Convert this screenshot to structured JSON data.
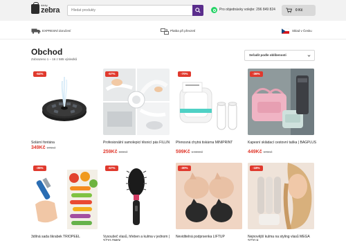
{
  "header": {
    "logo_small": "dárky",
    "logo_text": "zebra",
    "search_placeholder": "Hledat produkty",
    "phone_text": "Pro objednávky volejte: 296 849 824",
    "cart_price": "0 Kč"
  },
  "benefits": [
    {
      "icon": "truck-icon",
      "label": "EXPRESNÍ doručení"
    },
    {
      "icon": "exchange-icon",
      "label": "Platba při převzetí"
    },
    {
      "icon": "czech-flag-icon",
      "label": "Sklad v Česku"
    }
  ],
  "page": {
    "title": "Obchod",
    "results": "Zobrazeno 1 – 16 z 585 výsledků",
    "sort_label": "Seřadit podle oblíbenosti"
  },
  "products": [
    {
      "name": "Solární fontána",
      "price": "349Kč",
      "old_price": "979Kč",
      "badge": "-64%"
    },
    {
      "name": "Profesionální samolepicí těsnicí pás FILLIN",
      "price": "259Kč",
      "old_price": "599Kč",
      "badge": "-57%"
    },
    {
      "name": "Přenosná chytrá tiskárna MINIPRINT",
      "price": "599Kč",
      "old_price": "1 999Kč",
      "badge": "-70%"
    },
    {
      "name": "Kapesní skládací cestovní taška | BAGPLUS",
      "price": "449Kč",
      "old_price": "679Kč",
      "badge": "-36%"
    },
    {
      "name": "3dílná sada škrabek TRIOPEEL",
      "price": "",
      "old_price": "",
      "badge": "-35%"
    },
    {
      "name": "Vysoušeč vlasů, hřeben a kulma v jednom | STYLOMIX",
      "price": "",
      "old_price": "",
      "badge": "-67%"
    },
    {
      "name": "Neviditelná podprsenka LIFTUP",
      "price": "",
      "old_price": "",
      "badge": "-30%"
    },
    {
      "name": "Nejnovější kulma na styling vlasů MEGA STYLE",
      "price": "",
      "old_price": "",
      "badge": "-18%"
    }
  ],
  "colors": {
    "accent_purple": "#5a2d8c",
    "sale_red": "#e0392d",
    "header_bg": "#f2f2f2"
  }
}
